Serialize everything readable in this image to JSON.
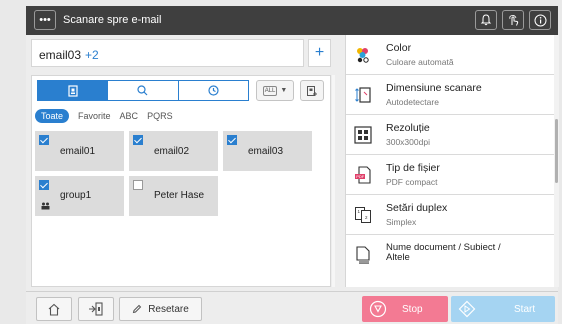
{
  "header": {
    "menu_icon": "ellipsis-icon",
    "title": "Scanare spre e-mail",
    "icons": [
      "bell-icon",
      "touch-hand-icon",
      "info-icon"
    ]
  },
  "destination": {
    "value": "email03",
    "extra_count": "+2",
    "add_label": "+"
  },
  "address_book": {
    "tabs": [
      "address-book-icon",
      "search-icon",
      "history-clock-icon"
    ],
    "active_tab": 0,
    "all_button": "ALL",
    "filters": [
      "Toate",
      "Favorite",
      "ABC",
      "PQRS"
    ],
    "active_filter": "Toate",
    "entries": [
      {
        "label": "email01",
        "checked": true
      },
      {
        "label": "email02",
        "checked": true
      },
      {
        "label": "email03",
        "checked": true
      },
      {
        "label": "group1",
        "checked": true,
        "group": true
      },
      {
        "label": "Peter Hase",
        "checked": false
      }
    ]
  },
  "options": [
    {
      "icon": "color-icon",
      "title": "Color",
      "subtitle": "Culoare automată"
    },
    {
      "icon": "scan-size-icon",
      "title": "Dimensiune scanare",
      "subtitle": "Autodetectare"
    },
    {
      "icon": "resolution-icon",
      "title": "Rezoluție",
      "subtitle": "300x300dpi"
    },
    {
      "icon": "file-type-icon",
      "title": "Tip de fișier",
      "subtitle": "PDF compact"
    },
    {
      "icon": "duplex-icon",
      "title": "Setări duplex",
      "subtitle": "Simplex"
    },
    {
      "icon": "document-name-icon",
      "title": "Nume document / Subiect /",
      "subtitle": "Altele"
    }
  ],
  "footer": {
    "home_icon": "home-icon",
    "access_icon": "access-icon",
    "reset_label": "Resetare",
    "stop_label": "Stop",
    "start_label": "Start"
  },
  "colors": {
    "accent": "#2a7fcf",
    "stop": "#f37a93",
    "start": "#a5d4f2",
    "header": "#3f3f3f"
  }
}
